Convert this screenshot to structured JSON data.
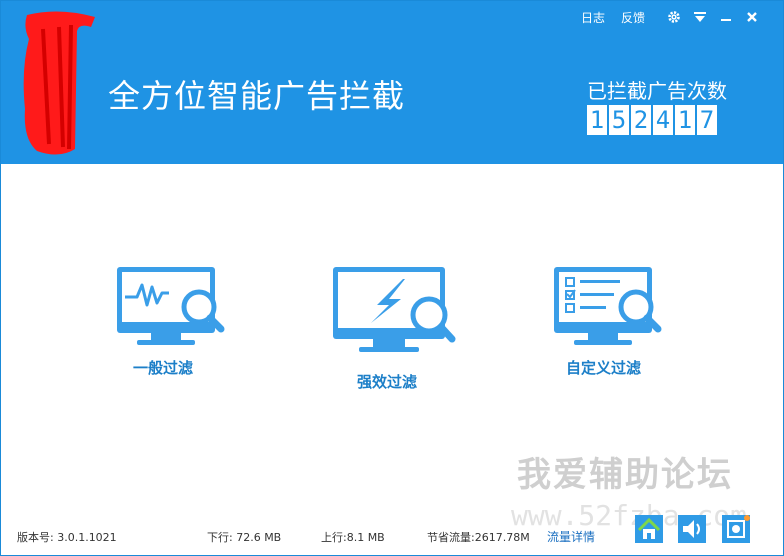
{
  "header": {
    "app_title": "全方位智能广告拦截",
    "counter_label": "已拦截广告次数",
    "counter_digits": [
      "1",
      "5",
      "2",
      "4",
      "1",
      "7"
    ]
  },
  "topbar": {
    "log_label": "日志",
    "feedback_label": "反馈",
    "icons": [
      "gear-icon",
      "dropdown-icon",
      "minimize-icon",
      "close-icon"
    ]
  },
  "modes": [
    {
      "label": "一般过滤",
      "icon": "monitor-waveform-icon"
    },
    {
      "label": "强效过滤",
      "icon": "monitor-lightning-icon"
    },
    {
      "label": "自定义过滤",
      "icon": "monitor-checklist-icon"
    }
  ],
  "watermark": {
    "text": "我爱辅助论坛",
    "url_text": "www.52fzba.com"
  },
  "status": {
    "version": "版本号: 3.0.1.1021",
    "download": "下行:  72.6 MB",
    "upload": "上行:8.1 MB",
    "saved": "节省流量:2617.78M",
    "details_link": "流量详情"
  },
  "colors": {
    "header_blue": "#1f93e4",
    "icon_blue": "#3a9ee8",
    "label_blue": "#1c7fc8"
  }
}
